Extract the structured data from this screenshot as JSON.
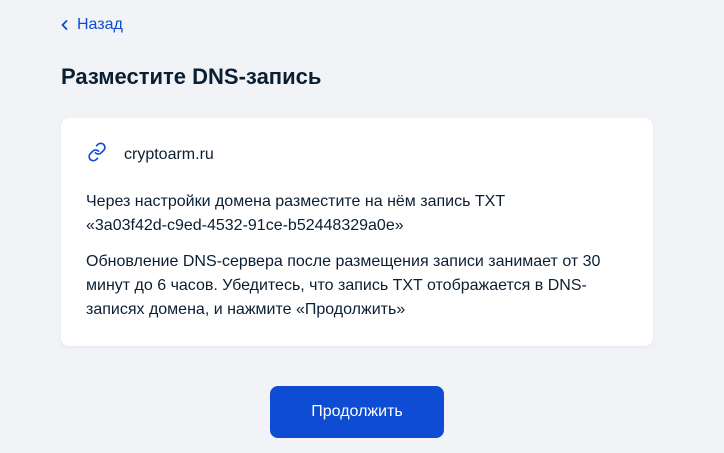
{
  "nav": {
    "back_label": "Назад",
    "back_icon": "chevron-left-icon"
  },
  "page": {
    "title": "Разместите DNS-запись"
  },
  "card": {
    "domain_icon": "link-icon",
    "domain": "cryptoarm.ru",
    "instruction_line1": "Через настройки домена разместите на нём запись TXT",
    "instruction_line2": "«3a03f42d-c9ed-4532-91ce-b52448329a0e»",
    "note": "Обновление DNS-сервера после размещения записи занимает от 30 минут до 6 часов. Убедитесь, что запись TXT отображается в DNS-записях домена, и нажмите «Продолжить»"
  },
  "actions": {
    "continue_label": "Продолжить"
  },
  "colors": {
    "accent": "#0d4cd3",
    "background": "#f1f3f7",
    "card": "#ffffff",
    "text": "#0b1f33"
  }
}
